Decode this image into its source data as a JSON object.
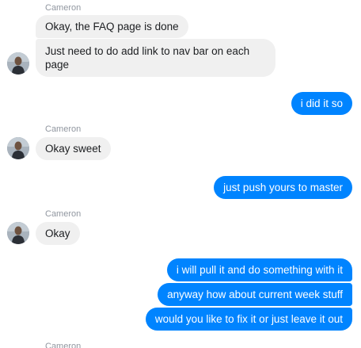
{
  "contact": {
    "name": "Cameron"
  },
  "messages": [
    {
      "from": "Cameron",
      "text": "Okay, the FAQ page is done"
    },
    {
      "from": "Cameron",
      "text": "Just need to do add link to nav bar on each page"
    },
    {
      "from": "me",
      "text": "i did it so"
    },
    {
      "from": "Cameron",
      "text": "Okay sweet"
    },
    {
      "from": "me",
      "text": "just push yours to master"
    },
    {
      "from": "Cameron",
      "text": "Okay"
    },
    {
      "from": "me",
      "text": "i will pull it and do something with it"
    },
    {
      "from": "me",
      "text": "anyway how about current week stuff"
    },
    {
      "from": "me",
      "text": "would you like to fix it or just leave it out"
    }
  ],
  "colors": {
    "outgoing_bubble": "#0084ff",
    "incoming_bubble": "#f0f0f0",
    "sender_label": "#9197a0"
  },
  "icons": {
    "avatar": "cameron-avatar-photo"
  }
}
